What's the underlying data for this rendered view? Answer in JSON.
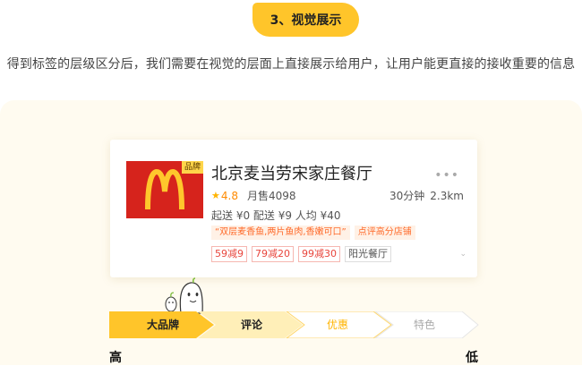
{
  "section": {
    "title": "3、视觉展示"
  },
  "intro": {
    "text": "得到标签的层级区分后，我们需要在视觉的层面上直接展示给用户，让用户能更直接的接收重要的信息"
  },
  "store": {
    "brand_tag": "品牌",
    "name": "北京麦当劳宋家庄餐厅",
    "rating": "4.8",
    "monthly_sales": "月售4098",
    "delivery_time": "30分钟",
    "distance": "2.3km",
    "fees": "起送 ¥0 配送 ¥9 人均 ¥40",
    "highlight_tags": [
      "“双层麦香鱼,两片鱼肉,香嫩可口”",
      "点评高分店铺"
    ],
    "discount_tags": [
      "59减9",
      "79减20",
      "99减30"
    ],
    "location_tag": "阳光餐厅"
  },
  "steps": {
    "items": [
      "大品牌",
      "评论",
      "优惠",
      "特色"
    ],
    "high_label": "高",
    "low_label": "低"
  },
  "colors": {
    "accent": "#ffc52a",
    "brand_red": "#d6231c",
    "discount_red": "#e8453c",
    "orange_tag": "#ff6a2a"
  },
  "icons": [
    "mcdonalds-logo-icon",
    "star-icon",
    "more-dots-icon",
    "chevron-down-icon",
    "mascot-icon"
  ]
}
